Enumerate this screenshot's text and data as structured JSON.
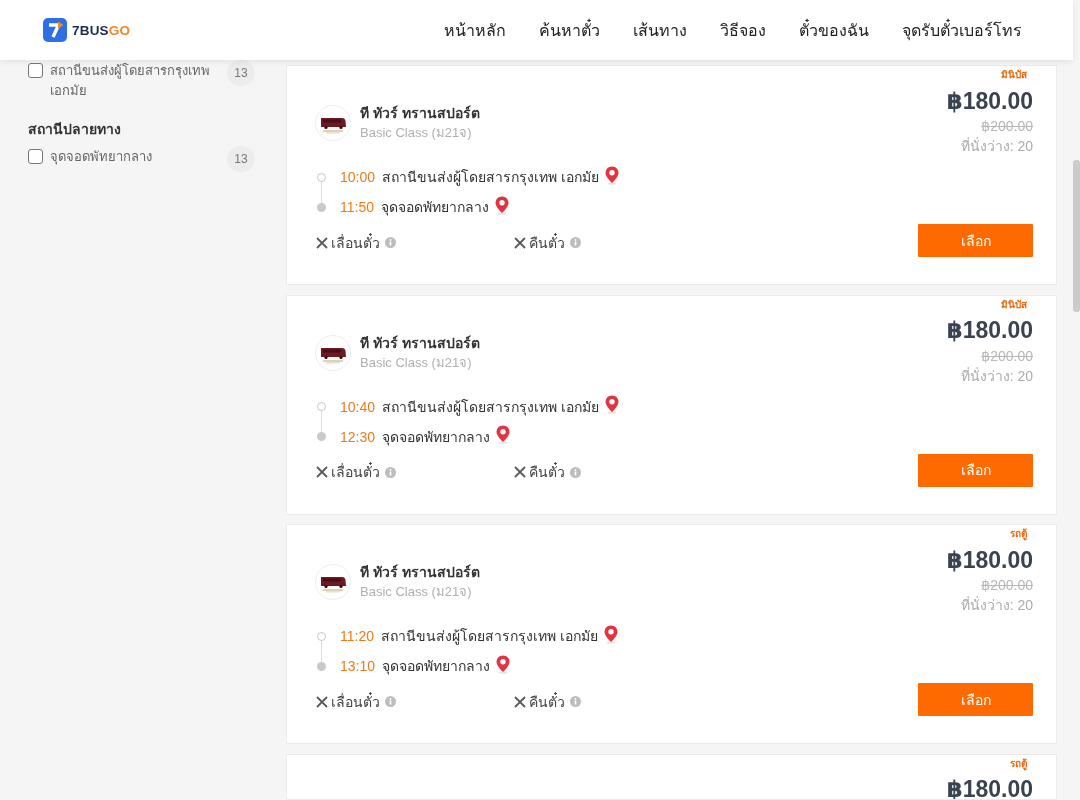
{
  "header": {
    "brand": {
      "name": "7BUS",
      "accent": "GO"
    },
    "nav": [
      "หน้าหลัก",
      "ค้นหาตั๋ว",
      "เส้นทาง",
      "วิธีจอง",
      "ตั๋วของฉัน",
      "จุดรับตั๋วเบอร์โทร"
    ]
  },
  "sidebar": {
    "filter_groups": [
      {
        "options": [
          {
            "label": "สถานีขนส่งผู้โดยสารกรุงเทพ เอกมัย",
            "count": "13",
            "checked": false
          }
        ]
      },
      {
        "heading": "สถานีปลายทาง",
        "options": [
          {
            "label": "จุดจอดพัทยากลาง",
            "count": "13",
            "checked": false
          }
        ]
      }
    ]
  },
  "trips": [
    {
      "vehicle_type": "มินิบัส",
      "operator": "ที ทัวร์ ทรานสปอร์ต",
      "class": "Basic Class (ม21จ)",
      "price": "฿180.00",
      "original_price": "฿200.00",
      "seats": "ที่นั่งว่าง: 20",
      "stops": [
        {
          "kind": "departure",
          "time": "10:00",
          "place": "สถานีขนส่งผู้โดยสารกรุงเทพ เอกมัย"
        },
        {
          "kind": "arrival",
          "time": "11:50",
          "place": "จุดจอดพัทยากลาง"
        }
      ],
      "policies": [
        {
          "label": "เลื่อนตั๋ว",
          "allowed": false
        },
        {
          "label": "คืนตั๋ว",
          "allowed": false
        }
      ],
      "button": "เลือก"
    },
    {
      "vehicle_type": "มินิบัส",
      "operator": "ที ทัวร์ ทรานสปอร์ต",
      "class": "Basic Class (ม21จ)",
      "price": "฿180.00",
      "original_price": "฿200.00",
      "seats": "ที่นั่งว่าง: 20",
      "stops": [
        {
          "kind": "departure",
          "time": "10:40",
          "place": "สถานีขนส่งผู้โดยสารกรุงเทพ เอกมัย"
        },
        {
          "kind": "arrival",
          "time": "12:30",
          "place": "จุดจอดพัทยากลาง"
        }
      ],
      "policies": [
        {
          "label": "เลื่อนตั๋ว",
          "allowed": false
        },
        {
          "label": "คืนตั๋ว",
          "allowed": false
        }
      ],
      "button": "เลือก"
    },
    {
      "vehicle_type": "รถตู้",
      "operator": "ที ทัวร์ ทรานสปอร์ต",
      "class": "Basic Class (ม21จ)",
      "price": "฿180.00",
      "original_price": "฿200.00",
      "seats": "ที่นั่งว่าง: 20",
      "stops": [
        {
          "kind": "departure",
          "time": "11:20",
          "place": "สถานีขนส่งผู้โดยสารกรุงเทพ เอกมัย"
        },
        {
          "kind": "arrival",
          "time": "13:10",
          "place": "จุดจอดพัทยากลาง"
        }
      ],
      "policies": [
        {
          "label": "เลื่อนตั๋ว",
          "allowed": false
        },
        {
          "label": "คืนตั๋ว",
          "allowed": false
        }
      ],
      "button": "เลือก"
    },
    {
      "vehicle_type": "รถตู้",
      "price": "฿180.00"
    }
  ]
}
